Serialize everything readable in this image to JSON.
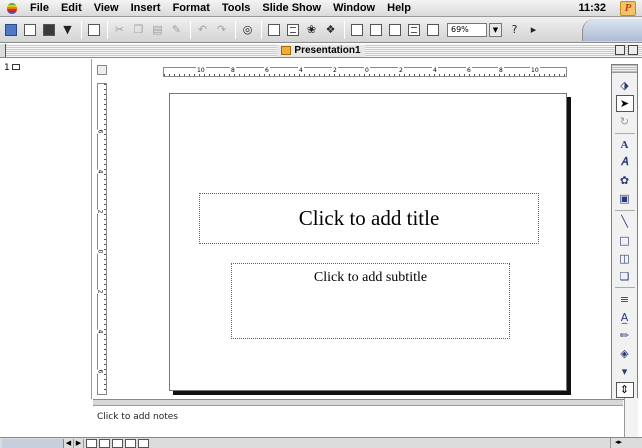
{
  "menubar": {
    "items": [
      "File",
      "Edit",
      "View",
      "Insert",
      "Format",
      "Tools",
      "Slide Show",
      "Window",
      "Help"
    ],
    "clock": "11:32",
    "app_icon_letter": "P"
  },
  "toolbar": {
    "zoom_value": "69%"
  },
  "window": {
    "title": "Presentation1"
  },
  "outline": {
    "slide_number": "1"
  },
  "rulers": {
    "h_labels": [
      "10",
      "8",
      "6",
      "4",
      "2",
      "0",
      "2",
      "4",
      "6",
      "8",
      "10"
    ],
    "v_labels": [
      "6",
      "4",
      "2",
      "0",
      "2",
      "4",
      "6"
    ]
  },
  "slide": {
    "title_placeholder": "Click to add title",
    "subtitle_placeholder": "Click to add subtitle"
  },
  "notes": {
    "placeholder": "Click to add notes"
  },
  "colors": {
    "slide_shadow": "#111111",
    "chrome_gray": "#d4d4d4",
    "draw_icon_blue": "#2a3a7a"
  }
}
